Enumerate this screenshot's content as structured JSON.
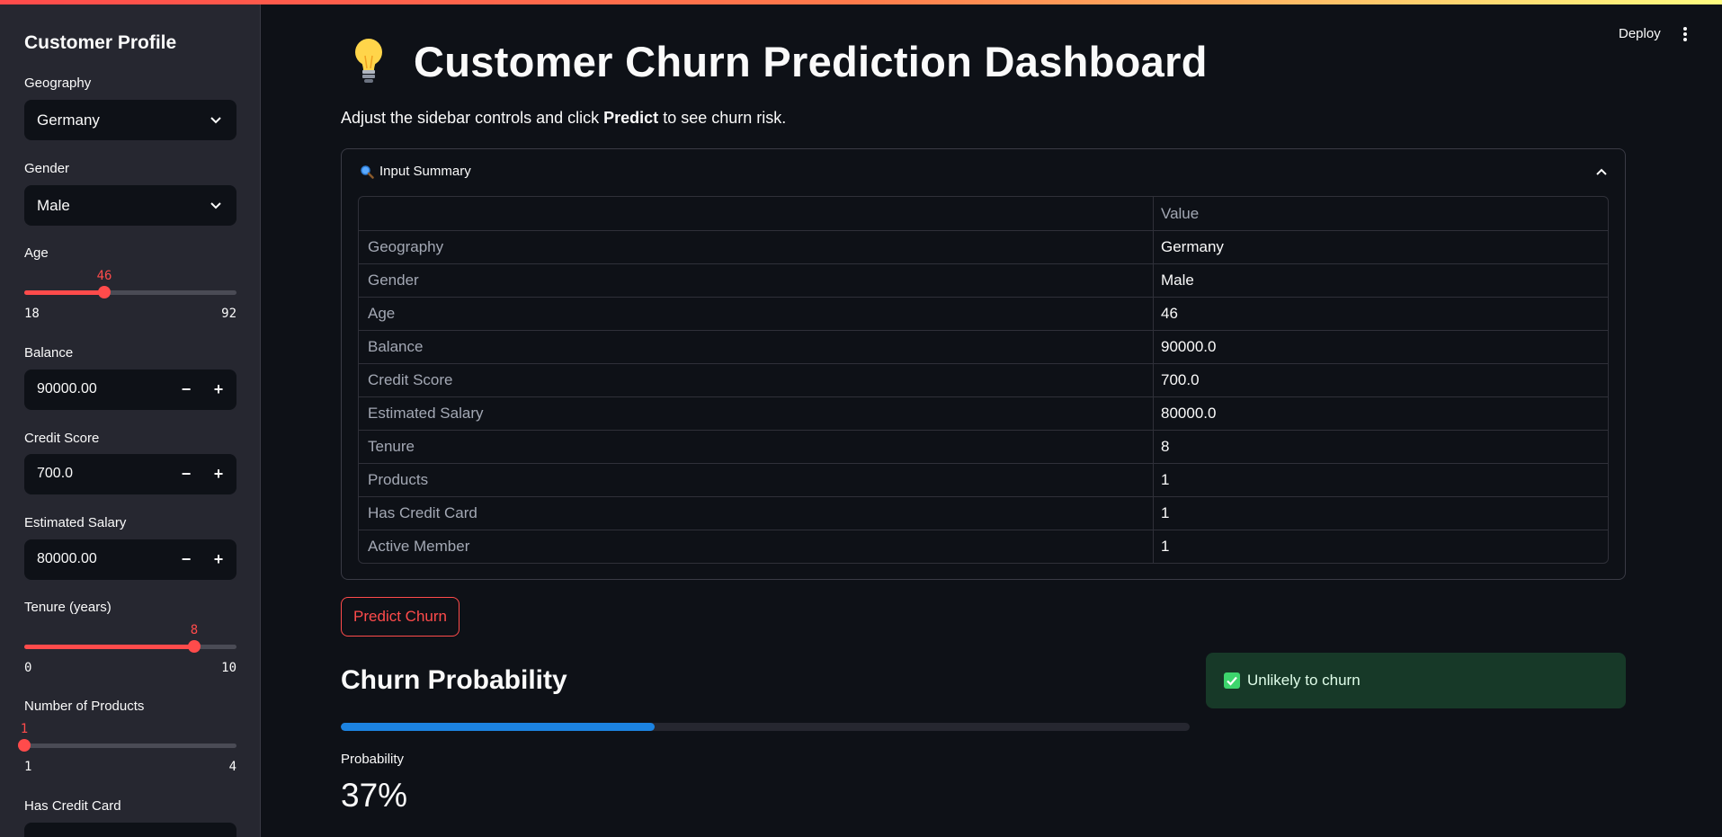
{
  "sidebar": {
    "title": "Customer Profile",
    "geography": {
      "label": "Geography",
      "value": "Germany"
    },
    "gender": {
      "label": "Gender",
      "value": "Male"
    },
    "age": {
      "label": "Age",
      "value": "46",
      "min": "18",
      "max": "92",
      "fraction": 0.378
    },
    "balance": {
      "label": "Balance",
      "value": "90000.00"
    },
    "credit_score": {
      "label": "Credit Score",
      "value": "700.0"
    },
    "estimated_salary": {
      "label": "Estimated Salary",
      "value": "80000.00"
    },
    "tenure": {
      "label": "Tenure (years)",
      "value": "8",
      "min": "0",
      "max": "10",
      "fraction": 0.8
    },
    "products": {
      "label": "Number of Products",
      "value": "1",
      "min": "1",
      "max": "4",
      "fraction": 0.0
    },
    "has_credit_card": {
      "label": "Has Credit Card"
    },
    "stepper_minus": "−",
    "stepper_plus": "+"
  },
  "header": {
    "deploy_label": "Deploy"
  },
  "main": {
    "title": "Customer Churn Prediction Dashboard",
    "intro_prefix": "Adjust the sidebar controls and click ",
    "intro_bold": "Predict",
    "intro_suffix": " to see churn risk.",
    "expander_label": "Input Summary",
    "table": {
      "header": [
        "",
        "Value"
      ],
      "rows": [
        [
          "Geography",
          "Germany"
        ],
        [
          "Gender",
          "Male"
        ],
        [
          "Age",
          "46"
        ],
        [
          "Balance",
          "90000.0"
        ],
        [
          "Credit Score",
          "700.0"
        ],
        [
          "Estimated Salary",
          "80000.0"
        ],
        [
          "Tenure",
          "8"
        ],
        [
          "Products",
          "1"
        ],
        [
          "Has Credit Card",
          "1"
        ],
        [
          "Active Member",
          "1"
        ]
      ]
    },
    "predict_label": "Predict Churn",
    "section_title": "Churn Probability",
    "probability_fraction": 0.37,
    "metric_label": "Probability",
    "metric_value": "37%",
    "alert_text": "Unlikely to churn"
  },
  "colors": {
    "accent": "#ff4b4b",
    "progress": "#1c83e1",
    "success_bg": "#173928",
    "sidebar_bg": "#262730",
    "main_bg": "#0e1117"
  },
  "icons": [
    "lightbulb-icon",
    "magnifier-icon",
    "chevron-down-icon",
    "chevron-up-icon",
    "check-box-icon",
    "kebab-menu-icon"
  ]
}
